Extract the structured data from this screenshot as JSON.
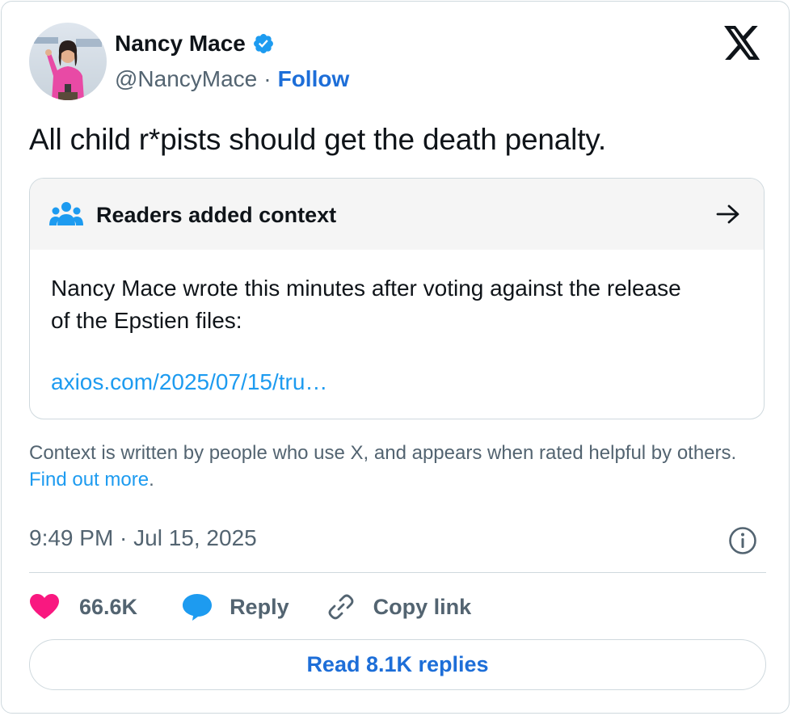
{
  "colors": {
    "accent_blue": "#1d9bf0",
    "follow_blue": "#1d6ed8",
    "muted_text": "#536471",
    "like_pink": "#f91880",
    "border": "#cfd9de"
  },
  "author": {
    "name": "Nancy Mace",
    "handle": "@NancyMace",
    "separator": "·",
    "follow_label": "Follow",
    "verified_icon": "verified-badge-icon",
    "avatar_icon": "profile-avatar"
  },
  "platform_icon": "x-logo-icon",
  "tweet": {
    "text": "All child r*pists should get the death penalty.",
    "timestamp": "9:49 PM · Jul 15, 2025"
  },
  "community_note": {
    "title": "Readers added context",
    "body": "Nancy Mace wrote this minutes after voting against the release of the Epstien files:",
    "link": "axios.com/2025/07/15/tru…",
    "footer_text": "Context is written by people who use X, and appears when rated helpful by others.",
    "footer_link": "Find out more",
    "footer_end": "."
  },
  "actions": {
    "likes": "66.6K",
    "reply_label": "Reply",
    "copy_label": "Copy link"
  },
  "read_replies_label": "Read 8.1K replies"
}
